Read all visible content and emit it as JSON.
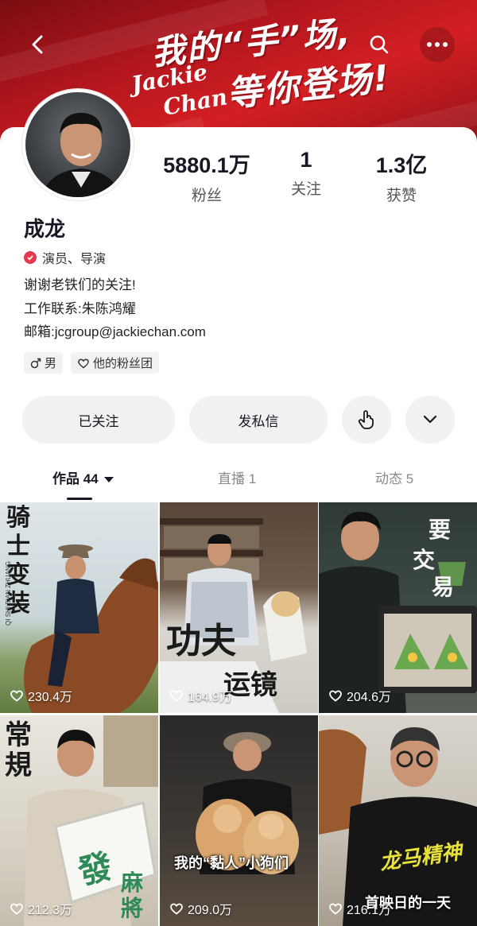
{
  "banner": {
    "headline_line1": "我的“手”场,",
    "headline_line2": "等你登场!",
    "logo_line1": "Jackie",
    "logo_line2": "Chan"
  },
  "profile": {
    "name": "成龙",
    "verified_text": "演员、导演",
    "bio": [
      "谢谢老铁们的关注!",
      "工作联系:朱陈鸿耀",
      "邮箱:jcgroup@jackiechan.com"
    ],
    "tags": {
      "gender": "男",
      "fan_club": "他的粉丝团"
    }
  },
  "stats": [
    {
      "value": "5880.1万",
      "label": "粉丝"
    },
    {
      "value": "1",
      "label": "关注"
    },
    {
      "value": "1.3亿",
      "label": "获赞"
    }
  ],
  "actions": {
    "follow": "已关注",
    "message": "发私信"
  },
  "tabs": [
    {
      "label": "作品 44"
    },
    {
      "label": "直播 1"
    },
    {
      "label": "动态 5"
    }
  ],
  "videos": [
    {
      "likes": "230.4万",
      "caption": [
        "骑",
        "士",
        "变",
        "装"
      ],
      "caption_small": "QI SHI BIAN ZHUANG"
    },
    {
      "likes": "164.9万",
      "caption": [
        "功",
        "夫",
        "运",
        "镜"
      ]
    },
    {
      "likes": "204.6万",
      "caption": [
        "要",
        "交",
        "易"
      ]
    },
    {
      "likes": "212.3万",
      "caption": [
        "常",
        "規"
      ],
      "caption2": [
        "麻",
        "將"
      ],
      "sign": "發"
    },
    {
      "likes": "209.0万",
      "caption_line": "我的“黏人”小狗们"
    },
    {
      "likes": "216.1万",
      "caption_line": "首映日的一天",
      "shirt": "龙马精神"
    }
  ],
  "colors": {
    "banner_red": "#d21f24",
    "verified_pink": "#e8384f",
    "button_gray": "#f1f1f2"
  }
}
